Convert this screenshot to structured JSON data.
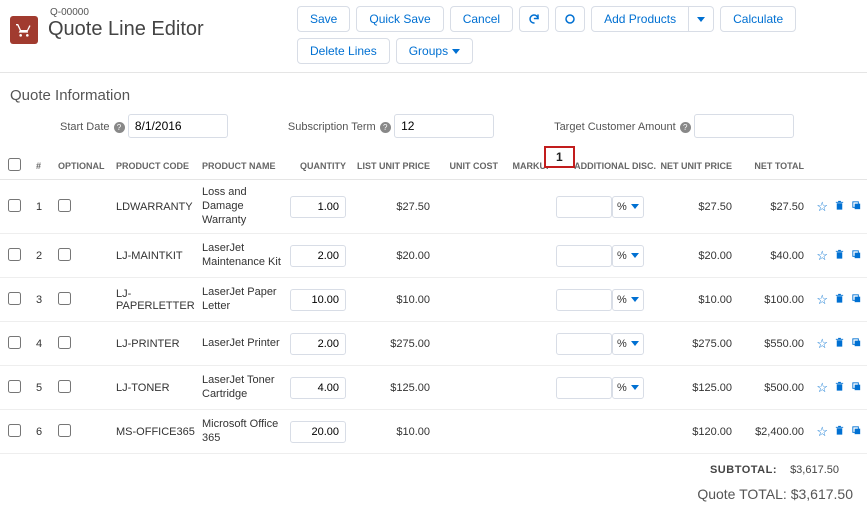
{
  "header": {
    "quote_number": "Q-00000",
    "title": "Quote Line Editor"
  },
  "toolbar": {
    "save": "Save",
    "quick_save": "Quick Save",
    "cancel": "Cancel",
    "add_products": "Add Products",
    "calculate": "Calculate",
    "delete_lines": "Delete Lines",
    "groups": "Groups"
  },
  "section": {
    "info_title": "Quote Information",
    "start_date_label": "Start Date",
    "start_date_value": "8/1/2016",
    "sub_term_label": "Subscription Term",
    "sub_term_value": "12",
    "target_amount_label": "Target Customer Amount",
    "target_amount_value": ""
  },
  "columns": {
    "num": "#",
    "optional": "OPTIONAL",
    "code": "PRODUCT CODE",
    "name": "PRODUCT NAME",
    "qty": "QUANTITY",
    "list_price": "LIST UNIT PRICE",
    "unit_cost": "UNIT COST",
    "markup": "MARKUP",
    "add_disc": "ADDITIONAL DISC.",
    "net_unit": "NET UNIT PRICE",
    "net_total": "NET TOTAL"
  },
  "callout": {
    "marker": "1"
  },
  "disc_unit": "%",
  "rows": [
    {
      "n": "1",
      "code": "LDWARRANTY",
      "name": "Loss and Damage Warranty",
      "qty": "1.00",
      "list": "$27.50",
      "net_unit": "$27.50",
      "net_total": "$27.50"
    },
    {
      "n": "2",
      "code": "LJ-MAINTKIT",
      "name": "LaserJet Maintenance Kit",
      "qty": "2.00",
      "list": "$20.00",
      "net_unit": "$20.00",
      "net_total": "$40.00"
    },
    {
      "n": "3",
      "code": "LJ-PAPERLETTER",
      "name": "LaserJet Paper Letter",
      "qty": "10.00",
      "list": "$10.00",
      "net_unit": "$10.00",
      "net_total": "$100.00"
    },
    {
      "n": "4",
      "code": "LJ-PRINTER",
      "name": "LaserJet Printer",
      "qty": "2.00",
      "list": "$275.00",
      "net_unit": "$275.00",
      "net_total": "$550.00"
    },
    {
      "n": "5",
      "code": "LJ-TONER",
      "name": "LaserJet Toner Cartridge",
      "qty": "4.00",
      "list": "$125.00",
      "net_unit": "$125.00",
      "net_total": "$500.00"
    },
    {
      "n": "6",
      "code": "MS-OFFICE365",
      "name": "Microsoft Office 365",
      "qty": "20.00",
      "list": "$10.00",
      "net_unit": "$120.00",
      "net_total": "$2,400.00"
    }
  ],
  "totals": {
    "subtotal_label": "SUBTOTAL:",
    "subtotal_value": "$3,617.50",
    "grand_label": "Quote TOTAL:",
    "grand_value": "$3,617.50"
  }
}
